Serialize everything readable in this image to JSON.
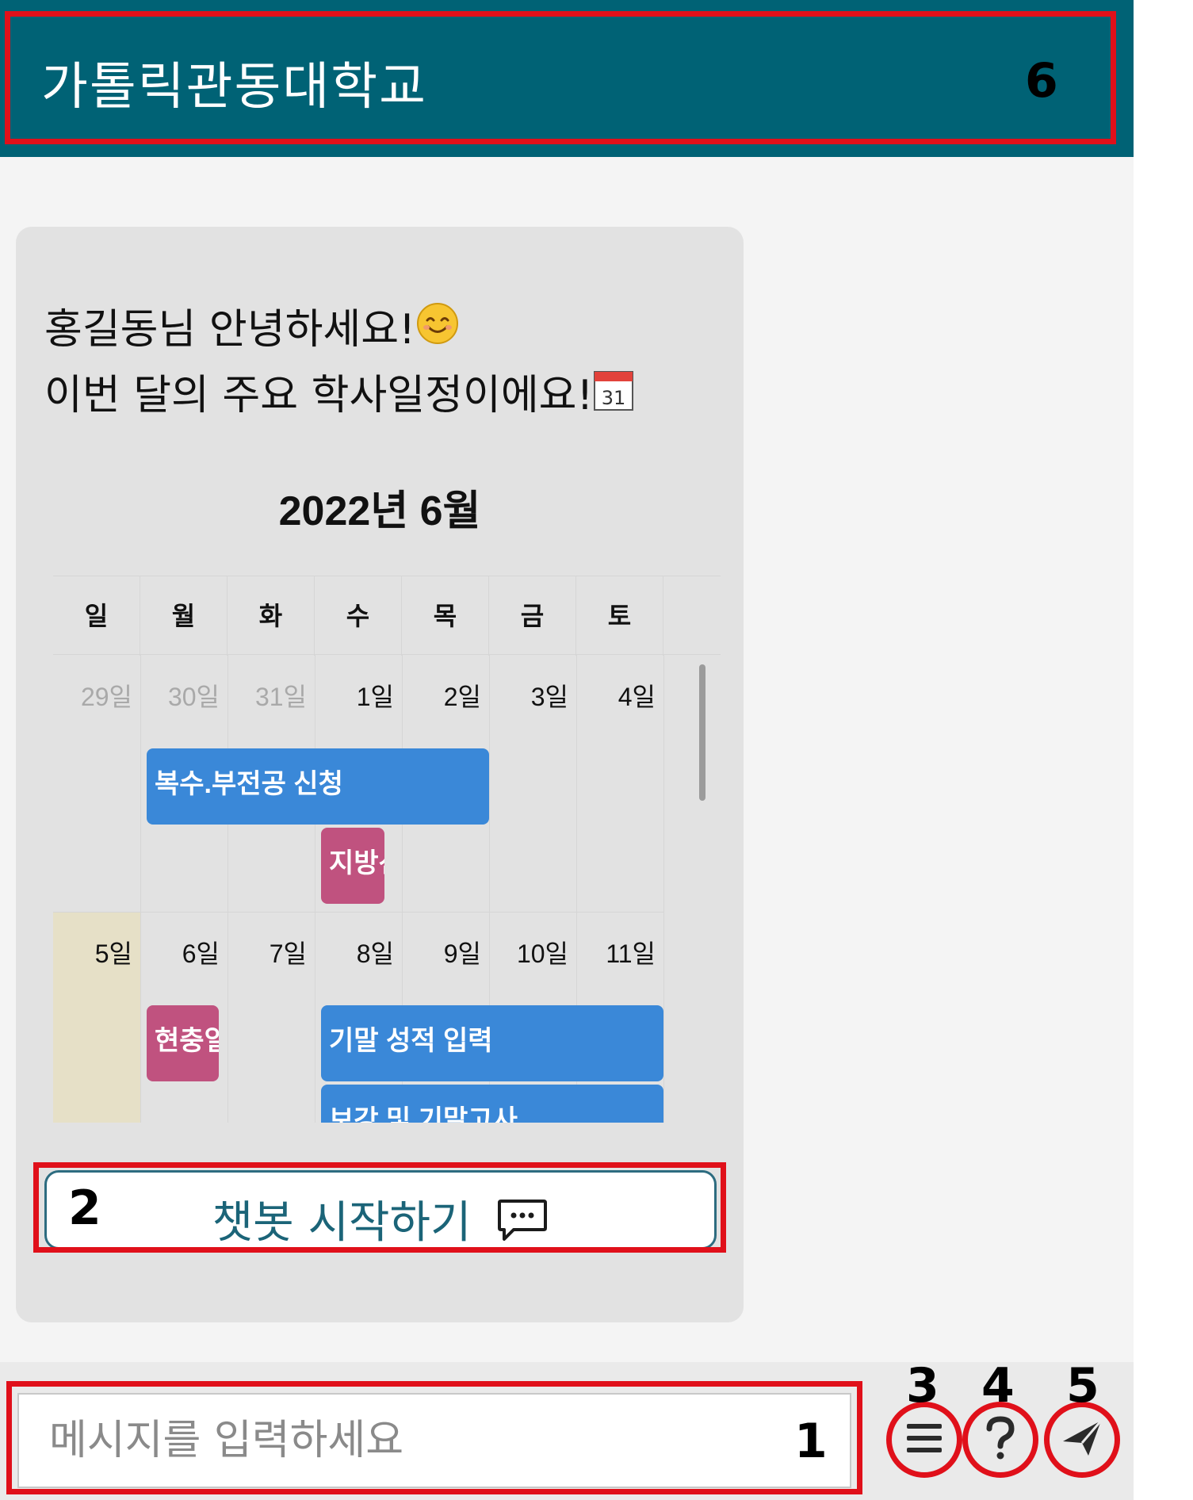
{
  "header": {
    "title": "가톨릭관동대학교"
  },
  "chat": {
    "greeting_line1": "홍길동님 안녕하세요!",
    "greeting_line2": "이번 달의 주요 학사일정이에요!",
    "greeting_emoji": "smiling-face-icon",
    "calendar_emoji": "calendar-icon",
    "calendar_emoji_text": "31"
  },
  "calendar": {
    "title": "2022년 6월",
    "weekdays": [
      "일",
      "월",
      "화",
      "수",
      "목",
      "금",
      "토"
    ],
    "weeks": [
      {
        "days": [
          "29일",
          "30일",
          "31일",
          "1일",
          "2일",
          "3일",
          "4일"
        ],
        "events": [
          {
            "label": "복수.부전공 신청",
            "color": "#3a88d8"
          },
          {
            "label": "지방선거",
            "color": "#c0527f"
          }
        ]
      },
      {
        "days": [
          "5일",
          "6일",
          "7일",
          "8일",
          "9일",
          "10일",
          "11일"
        ],
        "events": [
          {
            "label": "현충일",
            "color": "#c0527f"
          },
          {
            "label": "기말 성적 입력",
            "color": "#3a88d8"
          },
          {
            "label": "보강 및 기말고사",
            "color": "#3a88d8"
          }
        ]
      }
    ],
    "today_highlight": "#e6e0c7"
  },
  "start_button": {
    "label": "챗봇 시작하기",
    "icon": "speech-bubble-icon"
  },
  "input": {
    "placeholder": "메시지를 입력하세요"
  },
  "actions": {
    "menu_icon": "hamburger-menu-icon",
    "help_icon": "question-mark-icon",
    "send_icon": "send-paper-plane-icon"
  },
  "annotations": [
    "1",
    "2",
    "3",
    "4",
    "5",
    "6"
  ],
  "colors": {
    "header": "#006275",
    "accent": "#1b6478",
    "annotation": "#e0101a",
    "event_blue": "#3a88d8",
    "event_pink": "#c0527f"
  }
}
